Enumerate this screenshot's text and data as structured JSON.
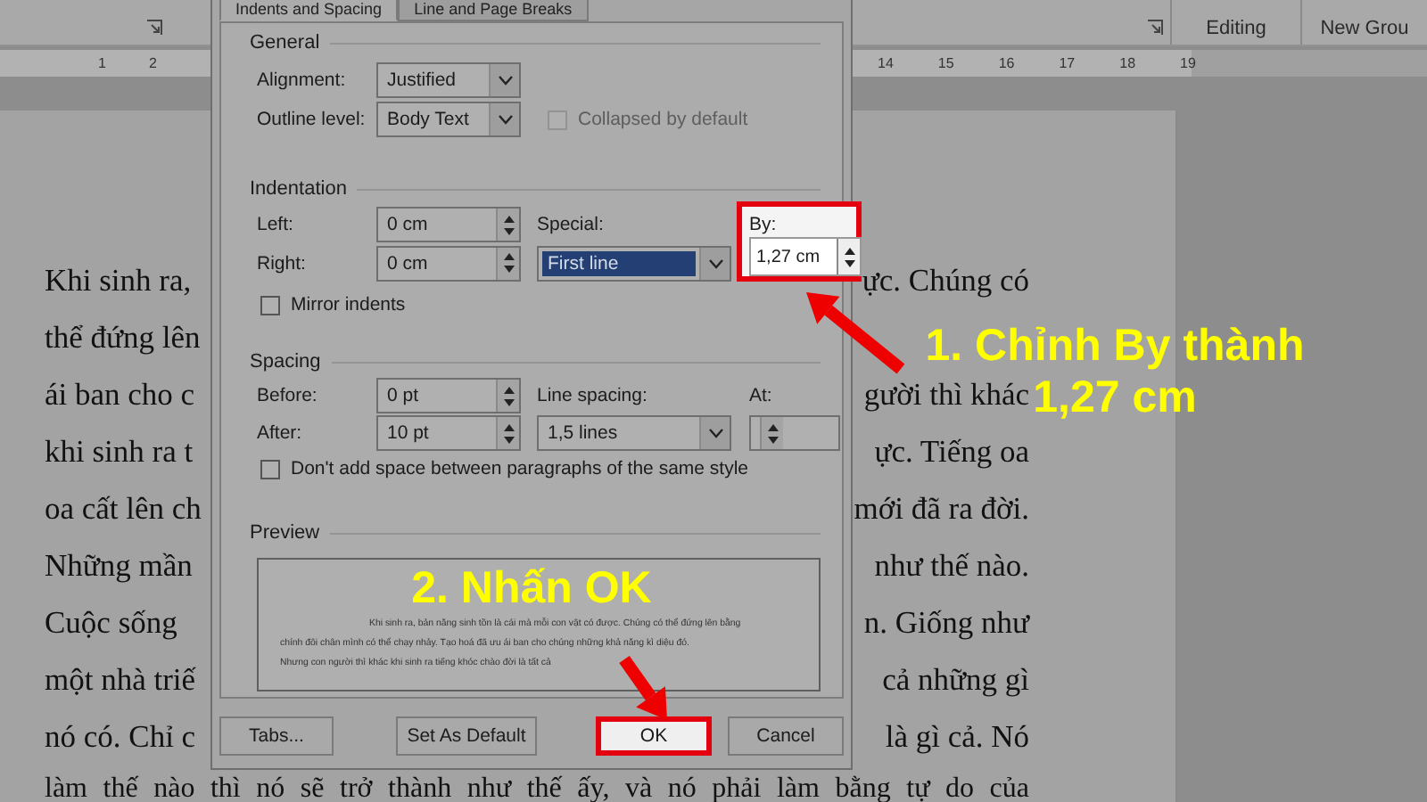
{
  "ribbon": {
    "groups": [
      {
        "label": "Editing"
      },
      {
        "label": "New Grou"
      }
    ]
  },
  "ruler": {
    "left_ticks": [
      "1",
      "2"
    ],
    "right_ticks": [
      "14",
      "15",
      "16",
      "17",
      "18",
      "19"
    ]
  },
  "document": {
    "lines": [
      {
        "left": "Khi sinh ra,",
        "right": "ực. Chúng có"
      },
      {
        "left": "thể đứng lên"
      },
      {
        "left": "ái ban cho c",
        "right": "gười thì khác"
      },
      {
        "left": "khi sinh ra t",
        "right": "ực. Tiếng oa"
      },
      {
        "left": "oa cất lên ch",
        "right": "mới đã ra đời."
      },
      {
        "left": "Những mần",
        "right": "như thế nào."
      },
      {
        "left": "Cuộc sống",
        "right": "n. Giống như"
      },
      {
        "left": "một nhà triế",
        "right": "cả những gì"
      },
      {
        "left": "nó có. Chỉ c",
        "right": "là gì cả. Nó"
      }
    ],
    "last_line": "làm thế nào thì nó sẽ trở thành như thế ấy, và nó phải làm bằng tự do của"
  },
  "dialog": {
    "tabs": [
      {
        "label": "Indents and Spacing",
        "selected": true
      },
      {
        "label": "Line and Page Breaks",
        "selected": false
      }
    ],
    "general": {
      "heading": "General",
      "alignment": {
        "label": "Alignment:",
        "value": "Justified"
      },
      "outline_level": {
        "label": "Outline level:",
        "value": "Body Text"
      },
      "collapsed": {
        "label": "Collapsed by default",
        "checked": false,
        "disabled": true
      }
    },
    "indentation": {
      "heading": "Indentation",
      "left": {
        "label": "Left:",
        "value": "0 cm"
      },
      "right": {
        "label": "Right:",
        "value": "0 cm"
      },
      "special": {
        "label": "Special:",
        "value": "First line",
        "selected": true
      },
      "by": {
        "label": "By:",
        "value": "1,27 cm",
        "highlighted": true
      },
      "mirror": {
        "label": "Mirror indents",
        "checked": false,
        "disabled": false
      }
    },
    "spacing": {
      "heading": "Spacing",
      "before": {
        "label": "Before:",
        "value": "0 pt"
      },
      "after": {
        "label": "After:",
        "value": "10 pt"
      },
      "line_spacing": {
        "label": "Line spacing:",
        "value": "1,5 lines",
        "selected": false
      },
      "at": {
        "label": "At:"
      },
      "dont_add": {
        "label": "Don't add space between paragraphs of the same style",
        "checked": false,
        "disabled": false
      }
    },
    "preview": {
      "heading": "Preview",
      "lines": [
        "Khi sinh ra, bản năng sinh tồn là cái mà mỗi con vật có được. Chúng có thể đứng lên bằng",
        "chính đôi chân mình có thể chạy nhảy. Tạo hoá đã ưu ái ban cho chúng những khả năng kì diệu đó.",
        "Nhưng con người thì khác khi sinh ra tiếng khóc chào đời là tất cả"
      ]
    },
    "buttons": [
      {
        "label": "Tabs...",
        "highlighted": false
      },
      {
        "label": "Set As Default",
        "highlighted": false
      },
      {
        "label": "OK",
        "highlighted": true
      },
      {
        "label": "Cancel",
        "highlighted": false
      }
    ]
  },
  "annotations": [
    {
      "kind": "step",
      "lines": [
        "1. Chỉnh By thành",
        "1,27 cm"
      ]
    },
    {
      "kind": "step",
      "lines": [
        "2. Nhấn OK"
      ]
    }
  ]
}
